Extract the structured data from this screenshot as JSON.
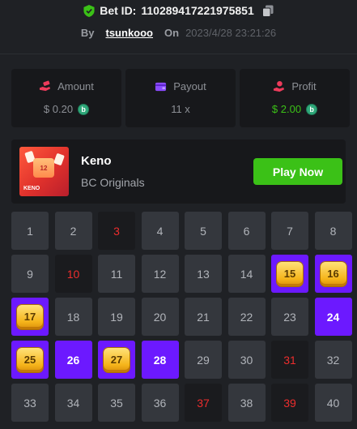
{
  "header": {
    "bet_label": "Bet ID:",
    "bet_id": "110289417221975851",
    "by_label": "By",
    "username": "tsunkooo",
    "on_label": "On",
    "date": "2023/4/28 23:21:26"
  },
  "stats": {
    "amount": {
      "label": "Amount",
      "value": "$ 0.20",
      "icon": "cash-hand-icon"
    },
    "payout": {
      "label": "Payout",
      "value": "11 x",
      "icon": "wallet-icon"
    },
    "profit": {
      "label": "Profit",
      "value": "$ 2.00",
      "icon": "profit-hand-icon"
    },
    "coin_symbol": "b"
  },
  "game": {
    "name": "Keno",
    "provider": "BC Originals",
    "thumb_number": "12",
    "thumb_label": "KENO",
    "play_label": "Play Now"
  },
  "colors": {
    "green": "#3bc117",
    "purple": "#6c19ff",
    "red": "#ed2d2d",
    "gold": "#f5b41a"
  },
  "grid": {
    "tiles": [
      {
        "n": "1",
        "s": "normal"
      },
      {
        "n": "2",
        "s": "normal"
      },
      {
        "n": "3",
        "s": "miss"
      },
      {
        "n": "4",
        "s": "normal"
      },
      {
        "n": "5",
        "s": "normal"
      },
      {
        "n": "6",
        "s": "normal"
      },
      {
        "n": "7",
        "s": "normal"
      },
      {
        "n": "8",
        "s": "normal"
      },
      {
        "n": "9",
        "s": "normal"
      },
      {
        "n": "10",
        "s": "miss"
      },
      {
        "n": "11",
        "s": "normal"
      },
      {
        "n": "12",
        "s": "normal"
      },
      {
        "n": "13",
        "s": "normal"
      },
      {
        "n": "14",
        "s": "normal"
      },
      {
        "n": "15",
        "s": "hit"
      },
      {
        "n": "16",
        "s": "hit"
      },
      {
        "n": "17",
        "s": "hit"
      },
      {
        "n": "18",
        "s": "normal"
      },
      {
        "n": "19",
        "s": "normal"
      },
      {
        "n": "20",
        "s": "normal"
      },
      {
        "n": "21",
        "s": "normal"
      },
      {
        "n": "22",
        "s": "normal"
      },
      {
        "n": "23",
        "s": "normal"
      },
      {
        "n": "24",
        "s": "pick"
      },
      {
        "n": "25",
        "s": "hit"
      },
      {
        "n": "26",
        "s": "pick"
      },
      {
        "n": "27",
        "s": "hit"
      },
      {
        "n": "28",
        "s": "pick"
      },
      {
        "n": "29",
        "s": "normal"
      },
      {
        "n": "30",
        "s": "normal"
      },
      {
        "n": "31",
        "s": "miss"
      },
      {
        "n": "32",
        "s": "normal"
      },
      {
        "n": "33",
        "s": "normal"
      },
      {
        "n": "34",
        "s": "normal"
      },
      {
        "n": "35",
        "s": "normal"
      },
      {
        "n": "36",
        "s": "normal"
      },
      {
        "n": "37",
        "s": "miss"
      },
      {
        "n": "38",
        "s": "normal"
      },
      {
        "n": "39",
        "s": "miss"
      },
      {
        "n": "40",
        "s": "normal"
      }
    ]
  }
}
